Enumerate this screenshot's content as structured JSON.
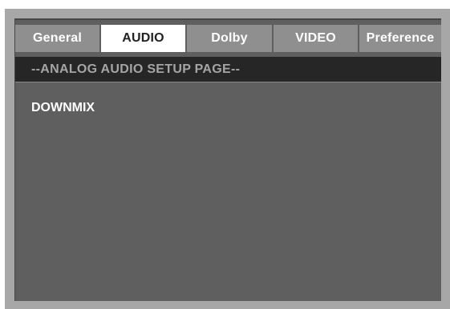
{
  "tabs": [
    {
      "label": "General",
      "active": false
    },
    {
      "label": "AUDIO",
      "active": true
    },
    {
      "label": "Dolby",
      "active": false
    },
    {
      "label": "VIDEO",
      "active": false
    },
    {
      "label": "Preference",
      "active": false
    }
  ],
  "page": {
    "title": "--ANALOG AUDIO SETUP PAGE--"
  },
  "menu": {
    "items": [
      {
        "label": "DOWNMIX"
      }
    ]
  },
  "colors": {
    "frame": "#a7a7a7",
    "screen": "#5f5f5f",
    "tab_inactive": "#8f8f8f",
    "tab_active": "#ffffff",
    "header_bar": "#262626",
    "header_text": "#a5a5a5"
  }
}
